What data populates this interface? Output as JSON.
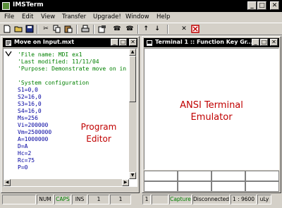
{
  "app": {
    "title": "IMSTerm"
  },
  "menu": [
    "File",
    "Edit",
    "View",
    "Transfer",
    "Upgrade!",
    "Window",
    "Help"
  ],
  "toolbar": {
    "icons": [
      "new-file-icon",
      "open-folder-icon",
      "save-icon",
      "cut-icon",
      "copy-icon",
      "paste-icon",
      "print-icon",
      "properties-icon",
      "phone-dial-icon",
      "phone-hangup-icon",
      "upload-arrow-icon",
      "download-arrow-icon",
      "cancel-x-icon",
      "stop-icon"
    ]
  },
  "editor": {
    "title": "Move on Input.mxt",
    "lines": [
      {
        "text": "'File name: MDI ex1",
        "type": "comment"
      },
      {
        "text": "'Last modified: 11/11/04",
        "type": "comment"
      },
      {
        "text": "'Purpose: Demonstrate move on in",
        "type": "comment"
      },
      {
        "text": "",
        "type": "code"
      },
      {
        "text": "'System configuration",
        "type": "comment"
      },
      {
        "text": "S1=0,0",
        "type": "code"
      },
      {
        "text": "S2=16,0",
        "type": "code"
      },
      {
        "text": "S3=16,0",
        "type": "code"
      },
      {
        "text": "S4=16,0",
        "type": "code"
      },
      {
        "text": "Ms=256",
        "type": "code"
      },
      {
        "text": "Vi=200000",
        "type": "code"
      },
      {
        "text": "Vm=2500000",
        "type": "code"
      },
      {
        "text": "A=1000000",
        "type": "code"
      },
      {
        "text": "D=A",
        "type": "code"
      },
      {
        "text": "Hc=2",
        "type": "code"
      },
      {
        "text": "Rc=75",
        "type": "code"
      },
      {
        "text": "P=0",
        "type": "code"
      }
    ],
    "overlay_label_line1": "Program",
    "overlay_label_line2": "Editor",
    "status": {
      "num": "NUM",
      "caps": "CAPS",
      "ins": "INS",
      "line": "1",
      "col": "1"
    }
  },
  "terminal": {
    "title": "Terminal 1 :: Function Key Gr...",
    "overlay_label_line1": "ANSI Terminal",
    "overlay_label_line2": "Emulator",
    "status": {
      "num": "1",
      "capture": "Capture",
      "connection": "Disconnected",
      "baud": "1 : 9600",
      "extra": "uLy"
    }
  },
  "colors": {
    "comment": "#008000",
    "code": "#0000a0",
    "overlay": "#c00000",
    "caps": "#008000",
    "capture": "#008000"
  }
}
